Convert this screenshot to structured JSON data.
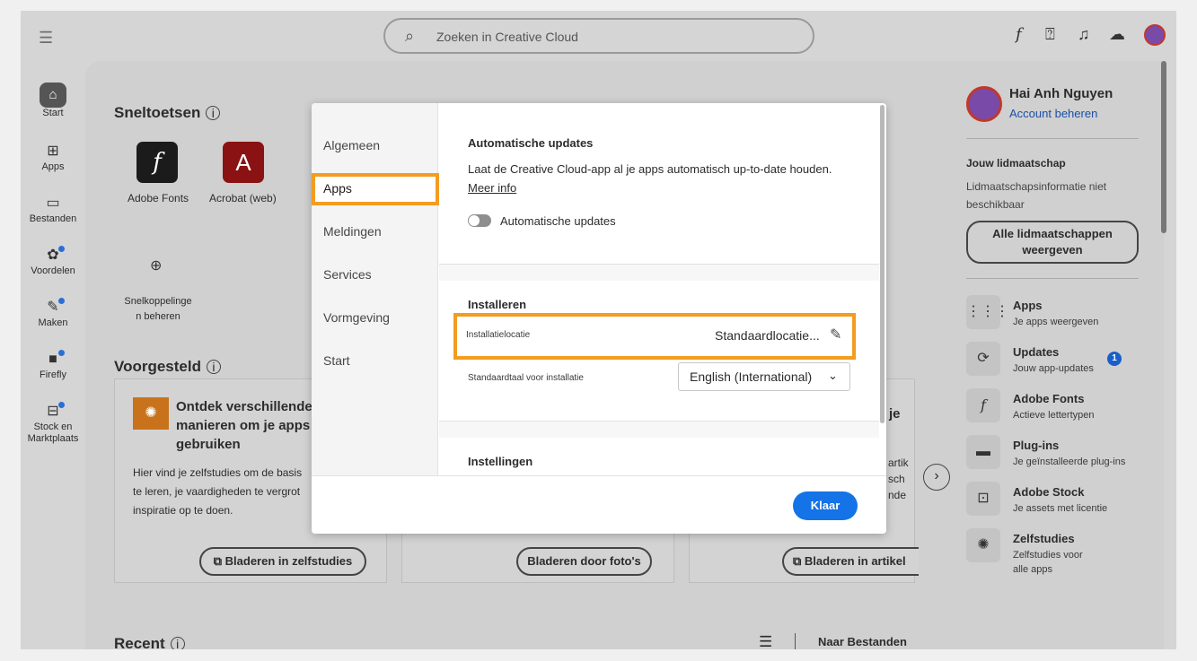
{
  "topbar": {
    "search_placeholder": "Zoeken in Creative Cloud",
    "icons": [
      "menu-icon",
      "search-icon",
      "fonts-icon",
      "help-icon",
      "bell-icon",
      "cloud-icon",
      "avatar"
    ]
  },
  "rail": [
    {
      "label": "Start",
      "icon": "home-icon"
    },
    {
      "label": "Apps",
      "icon": "apps-icon"
    },
    {
      "label": "Bestanden",
      "icon": "folder-icon"
    },
    {
      "label": "Voordelen",
      "icon": "gift-icon"
    },
    {
      "label": "Maken",
      "icon": "create-icon"
    },
    {
      "label": "Firefly",
      "icon": "firefly-icon"
    },
    {
      "label": "Stock en",
      "label2": "Marktplaats",
      "icon": "stock-icon"
    }
  ],
  "main": {
    "shortcuts_title": "Sneltoetsen",
    "apps": [
      {
        "label": "Adobe Fonts",
        "glyph": "f"
      },
      {
        "label": "Acrobat (web)",
        "glyph": "A"
      }
    ],
    "manage_label_1": "Snelkoppelinge",
    "manage_label_2": "n beheren",
    "suggested_title": "Voorgesteld",
    "card1": {
      "title_1": "Ontdek verschillende",
      "title_2": "manieren om je apps t",
      "title_3": "gebruiken",
      "body_1": "Hier vind je zelfstudies om de basis",
      "body_2": "te leren, je vaardigheden te vergrot",
      "body_3": "inspiratie op te doen.",
      "button": "Bladeren in zelfstudies"
    },
    "card2": {
      "button": "Bladeren door foto's"
    },
    "card3": {
      "title_frag": "je",
      "body_1": "artik",
      "body_2": "sch",
      "body_3": "nde",
      "button": "Bladeren in artikel"
    },
    "recent_title": "Recent",
    "to_files": "Naar Bestanden"
  },
  "right": {
    "user_name": "Hai Anh Nguyen",
    "account_link": "Account beheren",
    "membership_title": "Jouw lidmaatschap",
    "membership_text": "Lidmaatschapsinformatie niet beschikbaar",
    "membership_button": "Alle lidmaatschappen weergeven",
    "items": [
      {
        "title": "Apps",
        "sub": "Je apps weergeven",
        "icon": "grid-icon"
      },
      {
        "title": "Updates",
        "sub": "Jouw app-updates",
        "icon": "refresh-icon",
        "badge": "1"
      },
      {
        "title": "Adobe Fonts",
        "sub": "Actieve lettertypen",
        "icon": "fonts-icon"
      },
      {
        "title": "Plug-ins",
        "sub": "Je geïnstalleerde plug-ins",
        "icon": "plugin-icon"
      },
      {
        "title": "Adobe Stock",
        "sub": "Je assets met licentie",
        "icon": "stock-icon"
      },
      {
        "title": "Zelfstudies",
        "sub": "Zelfstudies voor alle apps",
        "icon": "bulb-icon"
      }
    ]
  },
  "modal": {
    "nav": [
      "Algemeen",
      "Apps",
      "Meldingen",
      "Services",
      "Vormgeving",
      "Start"
    ],
    "selected_nav": "Apps",
    "auto_updates_title": "Automatische updates",
    "auto_updates_text": "Laat de Creative Cloud-app al je apps automatisch up-to-date houden.",
    "more_info": "Meer info",
    "auto_updates_toggle": "Automatische updates",
    "auto_updates_on": false,
    "install_title": "Installeren",
    "install_location_label": "Installatielocatie",
    "install_location_value": "Standaardlocatie...",
    "default_lang_label": "Standaardtaal voor installatie",
    "default_lang_value": "English (International)",
    "settings_title": "Instellingen",
    "done_button": "Klaar"
  },
  "colors": {
    "accent": "#1473e6",
    "highlight": "#f39c20",
    "badge": "#1a5fc9"
  }
}
